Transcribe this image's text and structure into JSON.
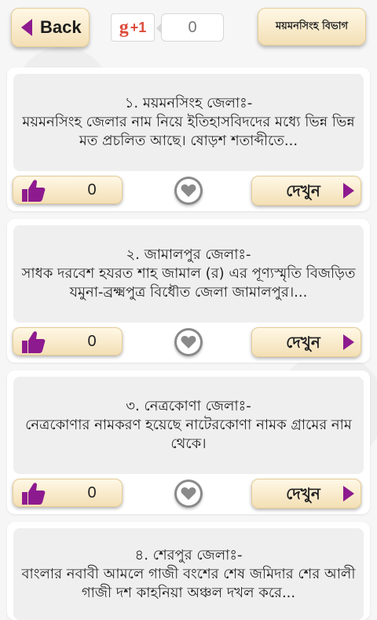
{
  "header": {
    "back_label": "Back",
    "gplus_label": "g",
    "gplus_plus": "+1",
    "gplus_count": "0",
    "division_label": "ময়মনসিংহ বিভাগ"
  },
  "colors": {
    "accent": "#8d1a8f",
    "button_bg": "#f3dfb5",
    "card_text_bg": "#efefef",
    "gplus_red": "#dd4b39"
  },
  "icons": {
    "back": "back-arrow-icon",
    "like": "thumbs-up-icon",
    "favorite": "heart-icon",
    "see": "play-arrow-icon"
  },
  "see_label": "দেখুন",
  "cards": [
    {
      "title": "১. ময়মনসিংহ জেলাঃ-",
      "description": "ময়মনসিংহ জেলার নাম নিয়ে ইতিহাসবিদদের মধ্যে ভিন্ন ভিন্ন মত প্রচলিত আছে। ষোড়শ শতাব্দীতে...",
      "likes": "0"
    },
    {
      "title": "২. জামালপুর জেলাঃ-",
      "description": "সাধক দরবেশ হযরত শাহ জামাল (র) এর পূণ্যস্মৃতি বিজড়িত যমুনা-ব্রক্ষ্মপুত্র বিধৌত জেলা জামালপুর।...",
      "likes": "0"
    },
    {
      "title": "৩. নেত্রকোণা জেলাঃ-",
      "description": "নেত্রকোণার নামকরণ হয়েছে নাটেরকোণা নামক গ্রামের নাম থেকে।",
      "likes": "0"
    },
    {
      "title": "৪. শেরপুর জেলাঃ-",
      "description": "বাংলার নবাবী আমলে গাজী বংশের শেষ জমিদার শের আলী গাজী দশ কাহনিয়া অঞ্চল দখল করে...",
      "likes": "0"
    }
  ]
}
